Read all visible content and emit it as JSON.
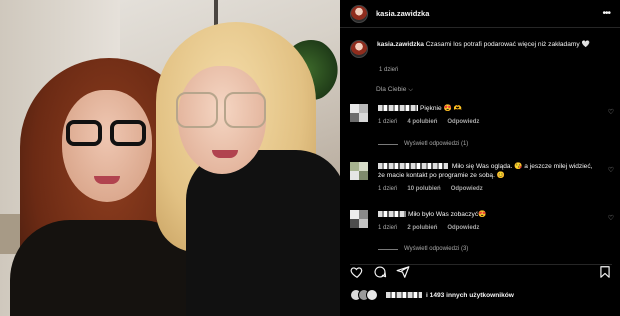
{
  "post": {
    "username": "kasia.zawidzka",
    "caption_user": "kasia.zawidzka",
    "caption_text": "Czasami los potrafi podarować więcej niż zakładamy 🤍",
    "caption_time": "1 dzień",
    "for_you_label": "Dla Ciebie",
    "liked_by_text": "i 1493 innych użytkowników"
  },
  "comments": [
    {
      "text_tail": "Pięknie 😍 🫶",
      "time": "1 dzień",
      "likes": "4 polubień",
      "reply": "Odpowiedz",
      "view_replies": "Wyświetl odpowiedzi (1)"
    },
    {
      "text_tail": " Miło się Was ogląda. 😘 a jeszcze milej widzieć, że macie kontakt po programie ze sobą. 😊",
      "time": "1 dzień",
      "likes": "10 polubień",
      "reply": "Odpowiedz"
    },
    {
      "text_tail": "Miło było Was zobaczyć😍",
      "time": "1 dzień",
      "likes": "2 polubień",
      "reply": "Odpowiedz",
      "view_replies": "Wyświetl odpowiedzi (3)"
    }
  ],
  "icons": {
    "more": "more-icon",
    "heart": "heart-icon",
    "comment": "comment-icon",
    "share": "share-icon",
    "bookmark": "bookmark-icon"
  },
  "colors": {
    "background": "#000000",
    "text": "#f5f5f5",
    "secondary_text": "#a8a8a8",
    "divider": "#262626"
  }
}
